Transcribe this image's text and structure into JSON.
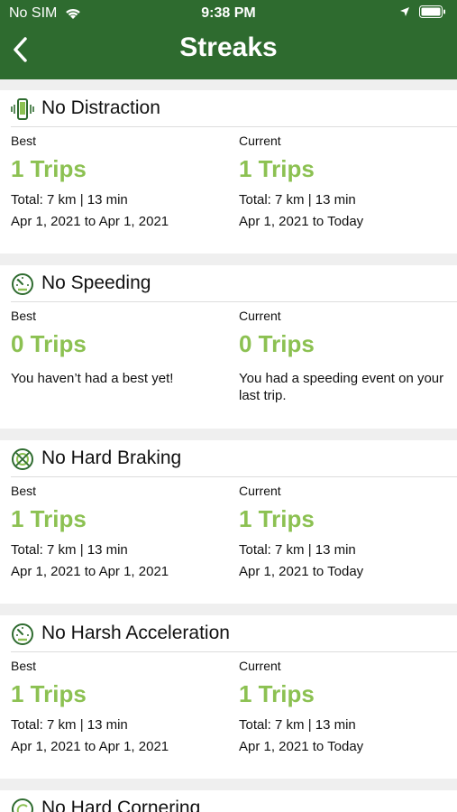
{
  "status": {
    "carrier": "No SIM",
    "time": "9:38 PM"
  },
  "header": {
    "title": "Streaks"
  },
  "labels": {
    "best": "Best",
    "current": "Current"
  },
  "cards": [
    {
      "name": "No Distraction",
      "icon": "phone-vibrate-icon",
      "best": {
        "trips": "1 Trips",
        "total": "Total: 7 km | 13 min",
        "range": "Apr 1, 2021 to Apr 1, 2021"
      },
      "current": {
        "trips": "1 Trips",
        "total": "Total: 7 km | 13 min",
        "range": "Apr 1, 2021 to Today"
      }
    },
    {
      "name": "No Speeding",
      "icon": "speedometer-icon",
      "best": {
        "trips": "0 Trips",
        "message": "You haven’t had a best yet!"
      },
      "current": {
        "trips": "0 Trips",
        "message": "You had a speeding event on your last trip."
      }
    },
    {
      "name": "No Hard Braking",
      "icon": "brake-icon",
      "best": {
        "trips": "1 Trips",
        "total": "Total: 7 km | 13 min",
        "range": "Apr 1, 2021 to Apr 1, 2021"
      },
      "current": {
        "trips": "1 Trips",
        "total": "Total: 7 km | 13 min",
        "range": "Apr 1, 2021 to Today"
      }
    },
    {
      "name": "No Harsh Acceleration",
      "icon": "speedometer-icon",
      "best": {
        "trips": "1 Trips",
        "total": "Total: 7 km | 13 min",
        "range": "Apr 1, 2021 to Apr 1, 2021"
      },
      "current": {
        "trips": "1 Trips",
        "total": "Total: 7 km | 13 min",
        "range": "Apr 1, 2021 to Today"
      }
    },
    {
      "name": "No Hard Cornering",
      "icon": "cornering-icon"
    }
  ],
  "colors": {
    "header": "#2e6b2f",
    "accent": "#8cc152",
    "icon": "#2e6b2f"
  }
}
